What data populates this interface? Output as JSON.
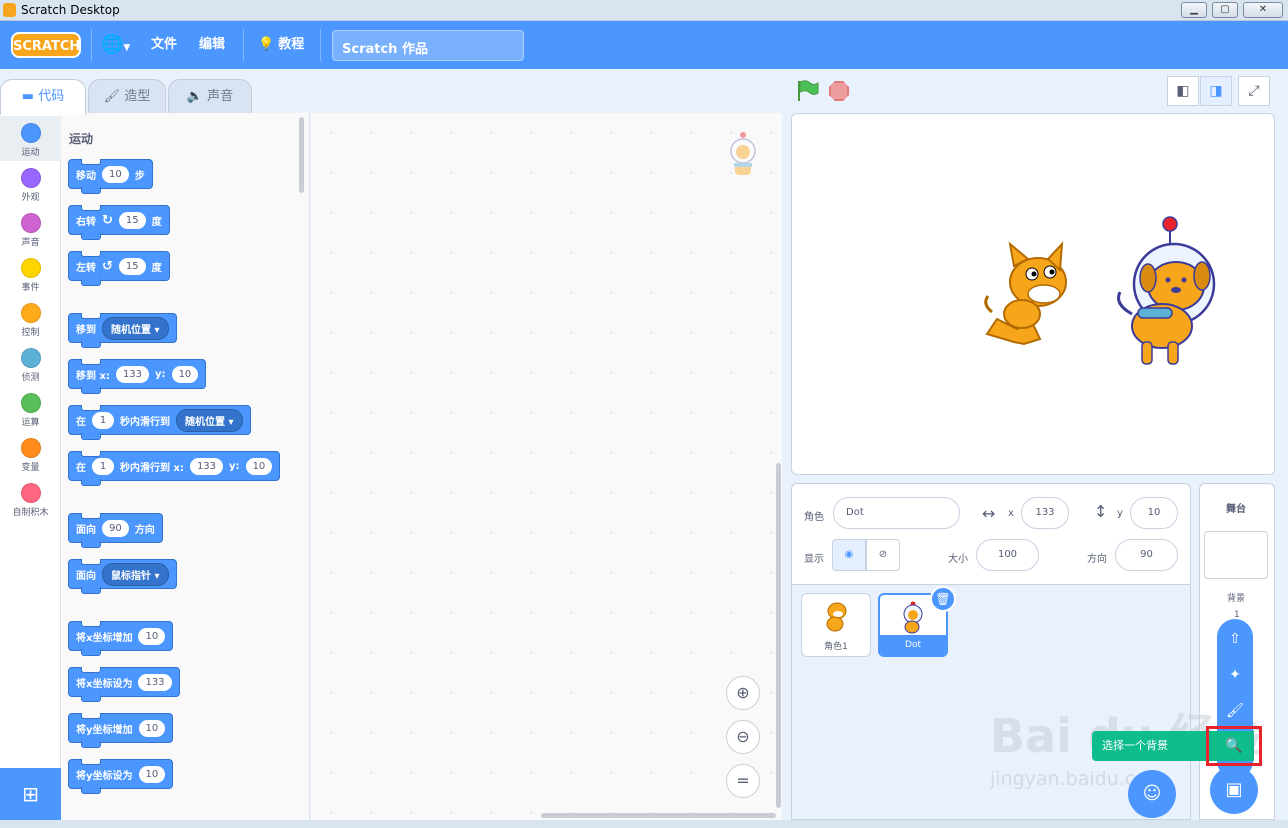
{
  "window": {
    "title": "Scratch Desktop",
    "controls": [
      "minimize",
      "maximize",
      "close"
    ]
  },
  "menubar": {
    "logo": "SCRATCH",
    "file": "文件",
    "edit": "编辑",
    "tutorials": "教程",
    "project_title": "Scratch 作品"
  },
  "tabs": [
    {
      "label": "代码",
      "icon": "code-icon",
      "active": true
    },
    {
      "label": "造型",
      "icon": "brush-icon",
      "active": false
    },
    {
      "label": "声音",
      "icon": "speaker-icon",
      "active": false
    }
  ],
  "categories": [
    {
      "label": "运动",
      "color": "#4c97ff",
      "active": true
    },
    {
      "label": "外观",
      "color": "#9966ff"
    },
    {
      "label": "声音",
      "color": "#cf63cf"
    },
    {
      "label": "事件",
      "color": "#ffd500"
    },
    {
      "label": "控制",
      "color": "#ffab19"
    },
    {
      "label": "侦测",
      "color": "#5cb1d6"
    },
    {
      "label": "运算",
      "color": "#59c059"
    },
    {
      "label": "变量",
      "color": "#ff8c1a"
    },
    {
      "label": "自制积木",
      "color": "#ff6680"
    }
  ],
  "palette": {
    "heading": "运动",
    "blocks": {
      "move": {
        "label": "移动",
        "value": "10",
        "suffix": "步"
      },
      "turn_right": {
        "label": "右转",
        "value": "15",
        "suffix": "度"
      },
      "turn_left": {
        "label": "左转",
        "value": "15",
        "suffix": "度"
      },
      "goto": {
        "label": "移到",
        "dropdown": "随机位置"
      },
      "goto_xy": {
        "label": "移到 x:",
        "x": "133",
        "ylabel": "y:",
        "y": "10"
      },
      "glide": {
        "prefix": "在",
        "secs": "1",
        "label": "秒内滑行到",
        "dropdown": "随机位置"
      },
      "glide_xy": {
        "prefix": "在",
        "secs": "1",
        "label": "秒内滑行到 x:",
        "x": "133",
        "ylabel": "y:",
        "y": "10"
      },
      "point_dir": {
        "label": "面向",
        "value": "90",
        "suffix": "方向"
      },
      "point_towards": {
        "label": "面向",
        "dropdown": "鼠标指针"
      },
      "change_x": {
        "label": "将x坐标增加",
        "value": "10"
      },
      "set_x": {
        "label": "将x坐标设为",
        "value": "133"
      },
      "change_y": {
        "label": "将y坐标增加",
        "value": "10"
      },
      "set_y": {
        "label": "将y坐标设为",
        "value": "10"
      }
    }
  },
  "zoom": {
    "in": "+",
    "out": "−",
    "reset": "="
  },
  "sprite_info": {
    "sprite_label": "角色",
    "sprite_name": "Dot",
    "x_label": "x",
    "x": "133",
    "y_label": "y",
    "y": "10",
    "show_label": "显示",
    "size_label": "大小",
    "size": "100",
    "direction_label": "方向",
    "direction": "90"
  },
  "sprites": [
    {
      "name": "角色1",
      "selected": false
    },
    {
      "name": "Dot",
      "selected": true
    }
  ],
  "stage_panel": {
    "title": "舞台",
    "backdrops_label": "背景",
    "backdrops_count": "1"
  },
  "tooltip": {
    "text": "选择一个背景"
  },
  "watermark": {
    "main": "Bai du 经验",
    "sub": "jingyan.baidu.com"
  },
  "colors": {
    "accent": "#4c97ff",
    "highlight": "#e8232b",
    "green": "#0fbd8c"
  }
}
